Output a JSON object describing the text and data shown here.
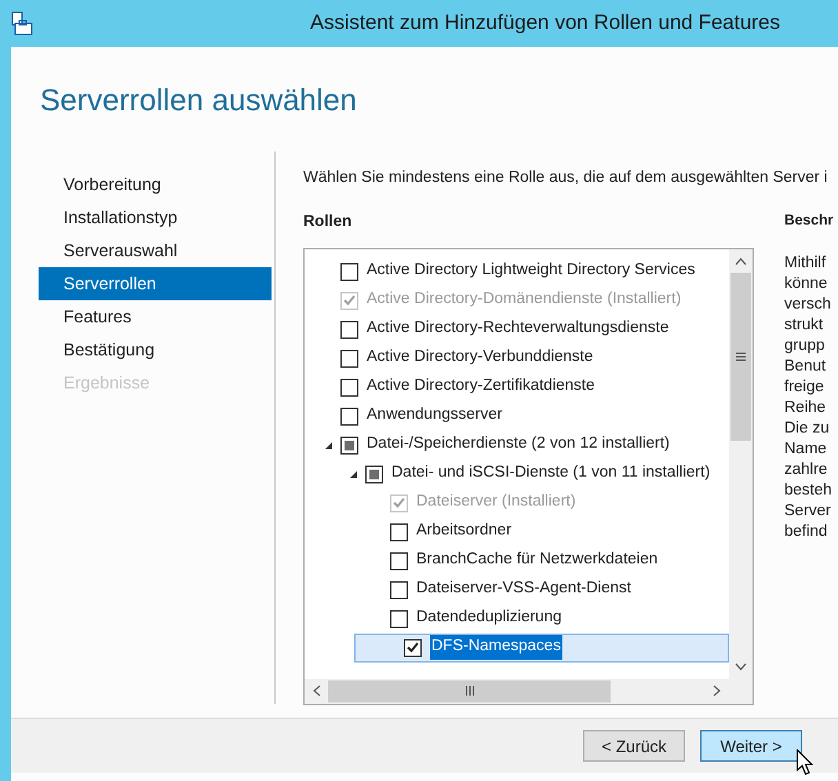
{
  "window": {
    "title": "Assistent zum Hinzufügen von Rollen und Features"
  },
  "heading": "Serverrollen auswählen",
  "steps": [
    {
      "label": "Vorbereitung",
      "selected": false,
      "disabled": false
    },
    {
      "label": "Installationstyp",
      "selected": false,
      "disabled": false
    },
    {
      "label": "Serverauswahl",
      "selected": false,
      "disabled": false
    },
    {
      "label": "Serverrollen",
      "selected": true,
      "disabled": false
    },
    {
      "label": "Features",
      "selected": false,
      "disabled": false
    },
    {
      "label": "Bestätigung",
      "selected": false,
      "disabled": false
    },
    {
      "label": "Ergebnisse",
      "selected": false,
      "disabled": true
    }
  ],
  "intro": "Wählen Sie mindestens eine Rolle aus, die auf dem ausgewählten Server i",
  "roles_heading": "Rollen",
  "roles": [
    {
      "label": "Active Directory Lightweight Directory Services",
      "checked": false,
      "disabled": false,
      "selected": false
    },
    {
      "label": "Active Directory-Domänendienste (Installiert)",
      "checked": true,
      "disabled": true,
      "selected": false
    },
    {
      "label": "Active Directory-Rechteverwaltungsdienste",
      "checked": false,
      "disabled": false,
      "selected": false
    },
    {
      "label": "Active Directory-Verbunddienste",
      "checked": false,
      "disabled": false,
      "selected": false
    },
    {
      "label": "Active Directory-Zertifikatdienste",
      "checked": false,
      "disabled": false,
      "selected": false
    },
    {
      "label": "Anwendungsserver",
      "checked": false,
      "disabled": false,
      "selected": false
    },
    {
      "label": "Datei-/Speicherdienste (2 von 12 installiert)",
      "checked": false,
      "indeterminate": true,
      "disabled": false,
      "selected": false,
      "expanded": true,
      "children": [
        {
          "label": "Datei- und iSCSI-Dienste (1 von 11 installiert)",
          "checked": false,
          "indeterminate": true,
          "disabled": false,
          "selected": false,
          "expanded": true,
          "children": [
            {
              "label": "Dateiserver (Installiert)",
              "checked": true,
              "disabled": true,
              "selected": false
            },
            {
              "label": "Arbeitsordner",
              "checked": false,
              "disabled": false,
              "selected": false
            },
            {
              "label": "BranchCache für Netzwerkdateien",
              "checked": false,
              "disabled": false,
              "selected": false
            },
            {
              "label": "Dateiserver-VSS-Agent-Dienst",
              "checked": false,
              "disabled": false,
              "selected": false
            },
            {
              "label": "Datendeduplizierung",
              "checked": false,
              "disabled": false,
              "selected": false
            },
            {
              "label": "DFS-Namespaces",
              "checked": true,
              "disabled": false,
              "selected": true
            }
          ]
        }
      ]
    }
  ],
  "description_heading": "Beschr",
  "description_lines": [
    "Mithilf",
    "könne",
    "versch",
    "strukt",
    "grupp",
    "Benut",
    "freige",
    "Reihe",
    "Die zu",
    "Name",
    "zahlre",
    "besteh",
    "Server",
    "befind"
  ],
  "buttons": [
    {
      "label": "< Zurück",
      "hovered": false
    },
    {
      "label": "Weiter >",
      "hovered": true
    }
  ]
}
